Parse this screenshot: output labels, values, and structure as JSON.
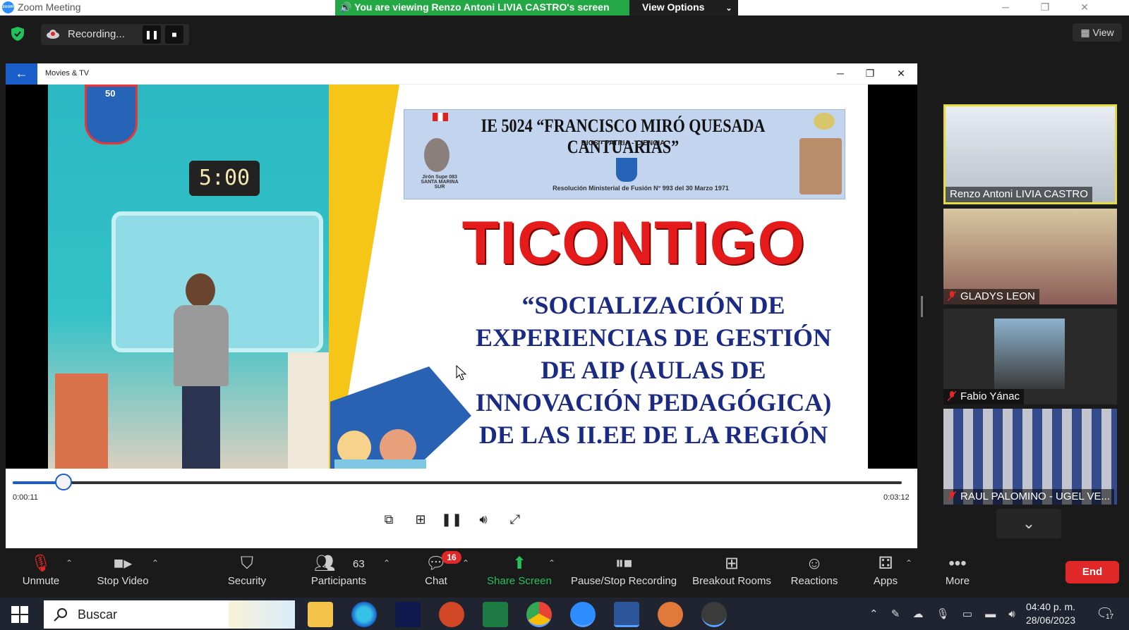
{
  "titlebar": {
    "app_title": "Zoom Meeting",
    "logo_text": "zoom",
    "viewing_banner": "You are viewing Renzo Antoni LIVIA CASTRO's screen",
    "view_options": "View Options"
  },
  "topbar": {
    "recording_label": "Recording...",
    "view_label": "View"
  },
  "shared_app": {
    "title": "Movies & TV",
    "video": {
      "clock_text": "5:00",
      "logo_number": "50",
      "school_name": "IE 5024 “FRANCISCO MIRÓ QUESADA CANTUARIAS”",
      "school_motto": "DIOS - PATRIA - CIENCIA",
      "school_location": "Jirón Supe 083 SANTA MARINA SUR",
      "school_resolution": "Resolución Ministerial de Fusión N° 993 del 30 Marzo 1971",
      "headline": "TICONTIGO",
      "subtitle": "“SOCIALIZACIÓN DE\nEXPERIENCIAS DE GESTIÓN\nDE AIP (AULAS DE\nINNOVACIÓN PEDAGÓGICA)\nDE LAS II.EE DE LA REGIÓN"
    },
    "player": {
      "current_time": "0:00:11",
      "total_time": "0:03:12",
      "progress": 0.057
    }
  },
  "gallery": {
    "participants": [
      {
        "name": "Renzo Antoni LIVIA CASTRO",
        "muted": false,
        "active_speaker": true
      },
      {
        "name": "GLADYS LEON",
        "muted": true,
        "active_speaker": false
      },
      {
        "name": "Fabio Yánac",
        "muted": true,
        "active_speaker": false
      },
      {
        "name": "RAUL PALOMINO - UGEL VE...",
        "muted": true,
        "active_speaker": false
      }
    ]
  },
  "meeting_toolbar": {
    "unmute": "Unmute",
    "stop_video": "Stop Video",
    "security": "Security",
    "participants": "Participants",
    "participants_count": "63",
    "chat": "Chat",
    "chat_badge": "16",
    "share_screen": "Share Screen",
    "pause_stop_recording": "Pause/Stop Recording",
    "breakout_rooms": "Breakout Rooms",
    "reactions": "Reactions",
    "apps": "Apps",
    "more": "More",
    "end": "End"
  },
  "taskbar": {
    "search_placeholder": "Buscar",
    "time": "04:40 p. m.",
    "date": "28/06/2023",
    "notification_count": "17",
    "apps": [
      "file-explorer-icon",
      "edge-icon",
      "stream-icon",
      "powerpoint-icon",
      "excel-icon",
      "chrome-icon",
      "zoom-icon",
      "word-icon",
      "game-icon",
      "media-player-icon"
    ]
  },
  "colors": {
    "share_green": "#23a845",
    "end_red": "#e02828",
    "accent_blue": "#1a5fc9",
    "speaker_border": "#e6dc3a"
  }
}
